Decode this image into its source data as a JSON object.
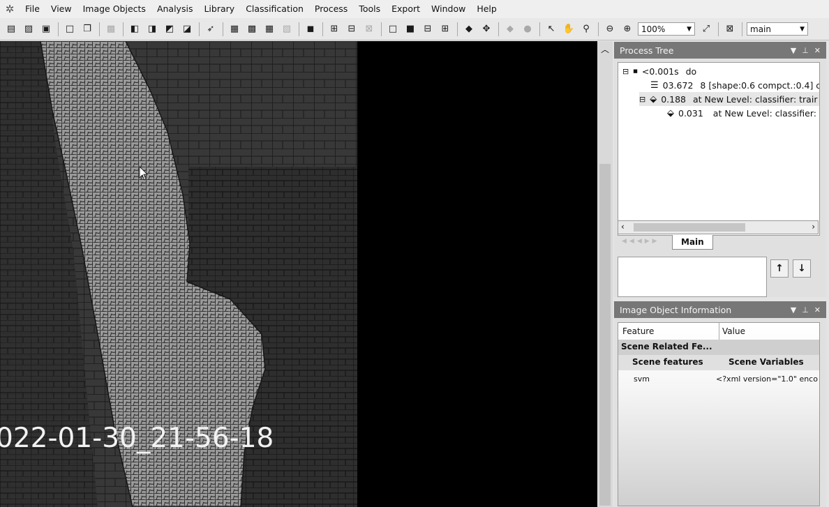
{
  "menu": [
    "File",
    "View",
    "Image Objects",
    "Analysis",
    "Library",
    "Classification",
    "Process",
    "Tools",
    "Export",
    "Window",
    "Help"
  ],
  "toolbar": {
    "zoom_value": "100%",
    "map_value": "main"
  },
  "viewer": {
    "timestamp": "022-01-30_21-56-18"
  },
  "process_tree": {
    "title": "Process Tree",
    "rows": [
      {
        "expander": "⊟",
        "time": "<0.001s",
        "text": "do"
      },
      {
        "expander": "",
        "time": "03.672",
        "text": "8 [shape:0.6 compct.:0.4] c"
      },
      {
        "expander": "⊟",
        "time": "0.188",
        "text": "at  New Level: classifier: trair"
      },
      {
        "expander": "",
        "time": "0.031",
        "text": "at  New Level: classifier:"
      }
    ],
    "tab_label": "Main"
  },
  "image_object_info": {
    "title": "Image Object Information",
    "col_feature": "Feature",
    "col_value": "Value",
    "group": "Scene Related Fe...",
    "sub_feature": "Scene features",
    "sub_value": "Scene Variables",
    "row_feature": "svm",
    "row_value": "<?xml version=\"1.0\" enco"
  },
  "colors": {
    "panel_title_bg": "#777777",
    "viewer_bg": "#000000"
  }
}
